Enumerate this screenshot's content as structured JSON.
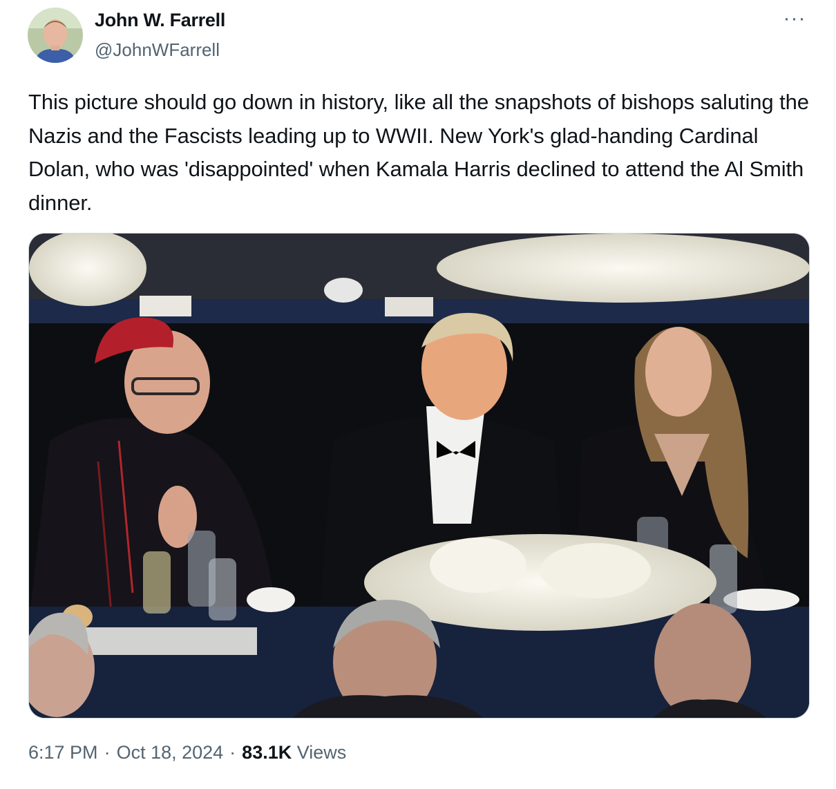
{
  "author": {
    "name": "John W. Farrell",
    "handle": "@JohnWFarrell",
    "avatar_icon": "profile-avatar"
  },
  "more_icon": "ellipsis-icon",
  "more_label": "···",
  "tweet": {
    "text": "This picture should go down in history, like all the snapshots of bishops saluting the Nazis and the Fascists leading up to WWII. New York's glad-handing Cardinal Dolan, who was 'disappointed' when Kamala Harris declined to attend the Al Smith dinner."
  },
  "meta": {
    "time": "6:17 PM",
    "separator": "·",
    "date": "Oct 18, 2024",
    "views_count": "83.1K",
    "views_label": "Views"
  },
  "colors": {
    "text_primary": "#0f1419",
    "text_secondary": "#536471",
    "border": "#cfd9de"
  }
}
